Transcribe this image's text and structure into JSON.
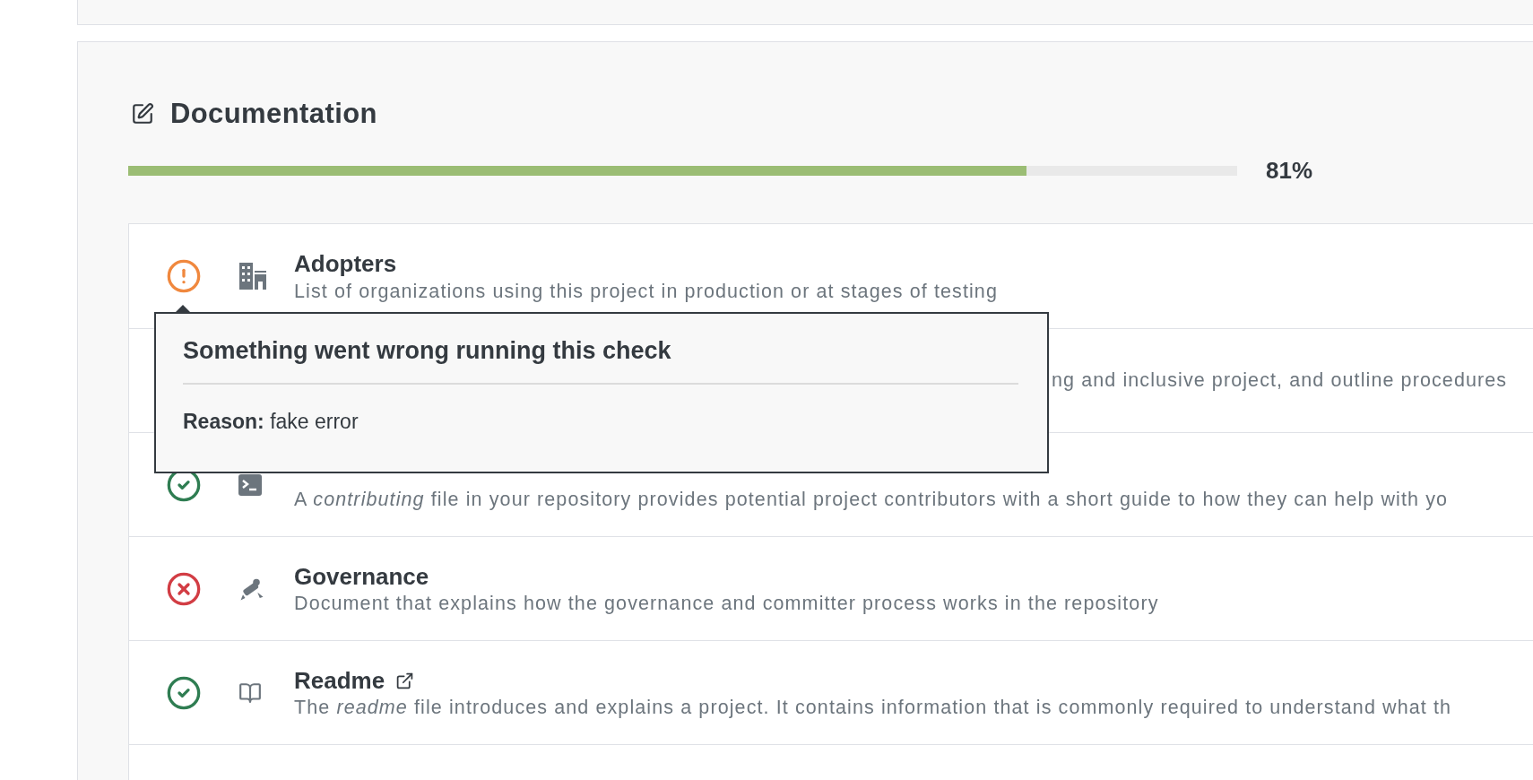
{
  "section": {
    "title": "Documentation",
    "level": 0.81,
    "reading": "81%"
  },
  "checks": [
    {
      "kind": "warning",
      "title": "Adopters",
      "link": false,
      "description": "List of organizations using this project in production or at stages of testing"
    },
    {
      "kind": "covered",
      "description": "ng and inclusive project, and outline procedures"
    },
    {
      "kind": "passed",
      "link": false,
      "description": "A *contributing* file in your repository provides potential project contributors with a short guide to how they can help with yo"
    },
    {
      "kind": "failed",
      "title": "Governance",
      "link": false,
      "description": "Document that explains how the governance and committer process works in the repository"
    },
    {
      "kind": "passed",
      "title": "Readme",
      "link": true,
      "description": "The *readme* file introduces and explains a project. It contains information that is commonly required to understand what th"
    },
    {
      "kind": "plain"
    }
  ],
  "tooltip": {
    "title": "Something went wrong running this check",
    "reason": "**Reason:** fake error"
  }
}
